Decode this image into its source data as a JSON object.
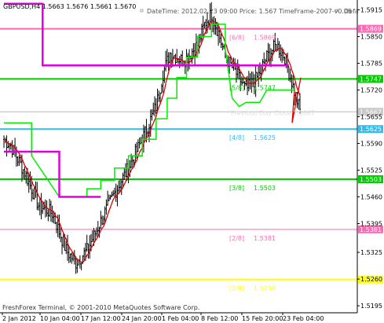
{
  "header": {
    "symbol_line": "GBPUSD,H4  1.5663 1.5676 1.5661 1.5670",
    "info_line": "DateTime: 2012.02.23 09:00    Price: 1.567    TimeFrame-2007-v0.05",
    "corner_text": "Defa"
  },
  "price_axis": {
    "ticks": [
      "1.5915",
      "1.5850",
      "1.5785",
      "1.5720",
      "1.5655",
      "1.5590",
      "1.5525",
      "1.5460",
      "1.5395",
      "1.5325",
      "1.5260",
      "1.5195"
    ]
  },
  "time_axis": {
    "labels": [
      "2 Jan 2012",
      "10 Jan 04:00",
      "17 Jan 12:00",
      "24 Jan 20:00",
      "1 Feb 04:00",
      "8 Feb 12:00",
      "15 Feb 20:00",
      "23 Feb 04:00"
    ]
  },
  "murrey_levels": [
    {
      "label": "[6/8]",
      "value": "1.5869",
      "tag": "1.5869",
      "color": "#ff69b4",
      "tag_bg": "#ff69b4"
    },
    {
      "label": "[5/8]",
      "value": "1.5747",
      "tag": "1.5747",
      "color": "#00cc00",
      "tag_bg": "#00cc00"
    },
    {
      "label": "[4/8]",
      "value": "1.5625",
      "tag": "1.5625",
      "color": "#33bbee",
      "tag_bg": "#33bbee"
    },
    {
      "label": "[3/8]",
      "value": "1.5503",
      "tag": "1.5503",
      "color": "#00cc00",
      "tag_bg": "#00cc00"
    },
    {
      "label": "[2/8]",
      "value": "1.5381",
      "tag": "1.5381",
      "color": "#ff69b4",
      "tag_bg": "#ff69b4"
    },
    {
      "label": "[1/8]",
      "value": "1.5259",
      "tag": "1.5259",
      "color": "#ffff00",
      "tag_bg": "#ffff00"
    }
  ],
  "current_price": {
    "tag": "1.5667",
    "overlay_text": "Previous Day Close 1.5667"
  },
  "footer": {
    "copyright": "FreshForex Terminal, © 2001-2010 MetaQuotes Software Corp."
  },
  "colors": {
    "candles": "#000000",
    "magenta_line": "#dd00dd",
    "green_line": "#00ee00",
    "red_line": "#dd0000",
    "current_line": "#bbbbbb"
  }
}
